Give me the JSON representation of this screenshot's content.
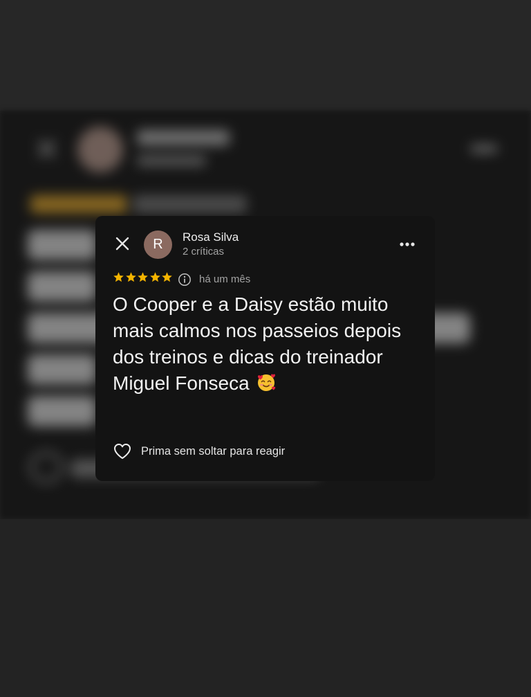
{
  "background": {
    "colors": {
      "panel": "#161616",
      "page": "#232323"
    }
  },
  "review": {
    "author_initial": "R",
    "author_name": "Rosa Silva",
    "author_reviews": "2 críticas",
    "rating": 5,
    "rating_max": 5,
    "time": "há um mês",
    "text": "O Cooper e a Daisy estão muito mais calmos nos passeios depois dos treinos e dicas do treinador Miguel Fonseca",
    "emoji": "smiling-face-with-hearts",
    "react_label": "Prima sem soltar para reagir"
  },
  "icons": {
    "close": "close-icon",
    "more": "more-horizontal-icon",
    "info": "info-icon",
    "star": "star-icon",
    "heart": "heart-outline-icon"
  },
  "colors": {
    "card": "#131313",
    "star": "#f4b400",
    "avatar": "#8b6a60",
    "text_primary": "#f2f2f2",
    "text_secondary": "#a3a3a3"
  }
}
